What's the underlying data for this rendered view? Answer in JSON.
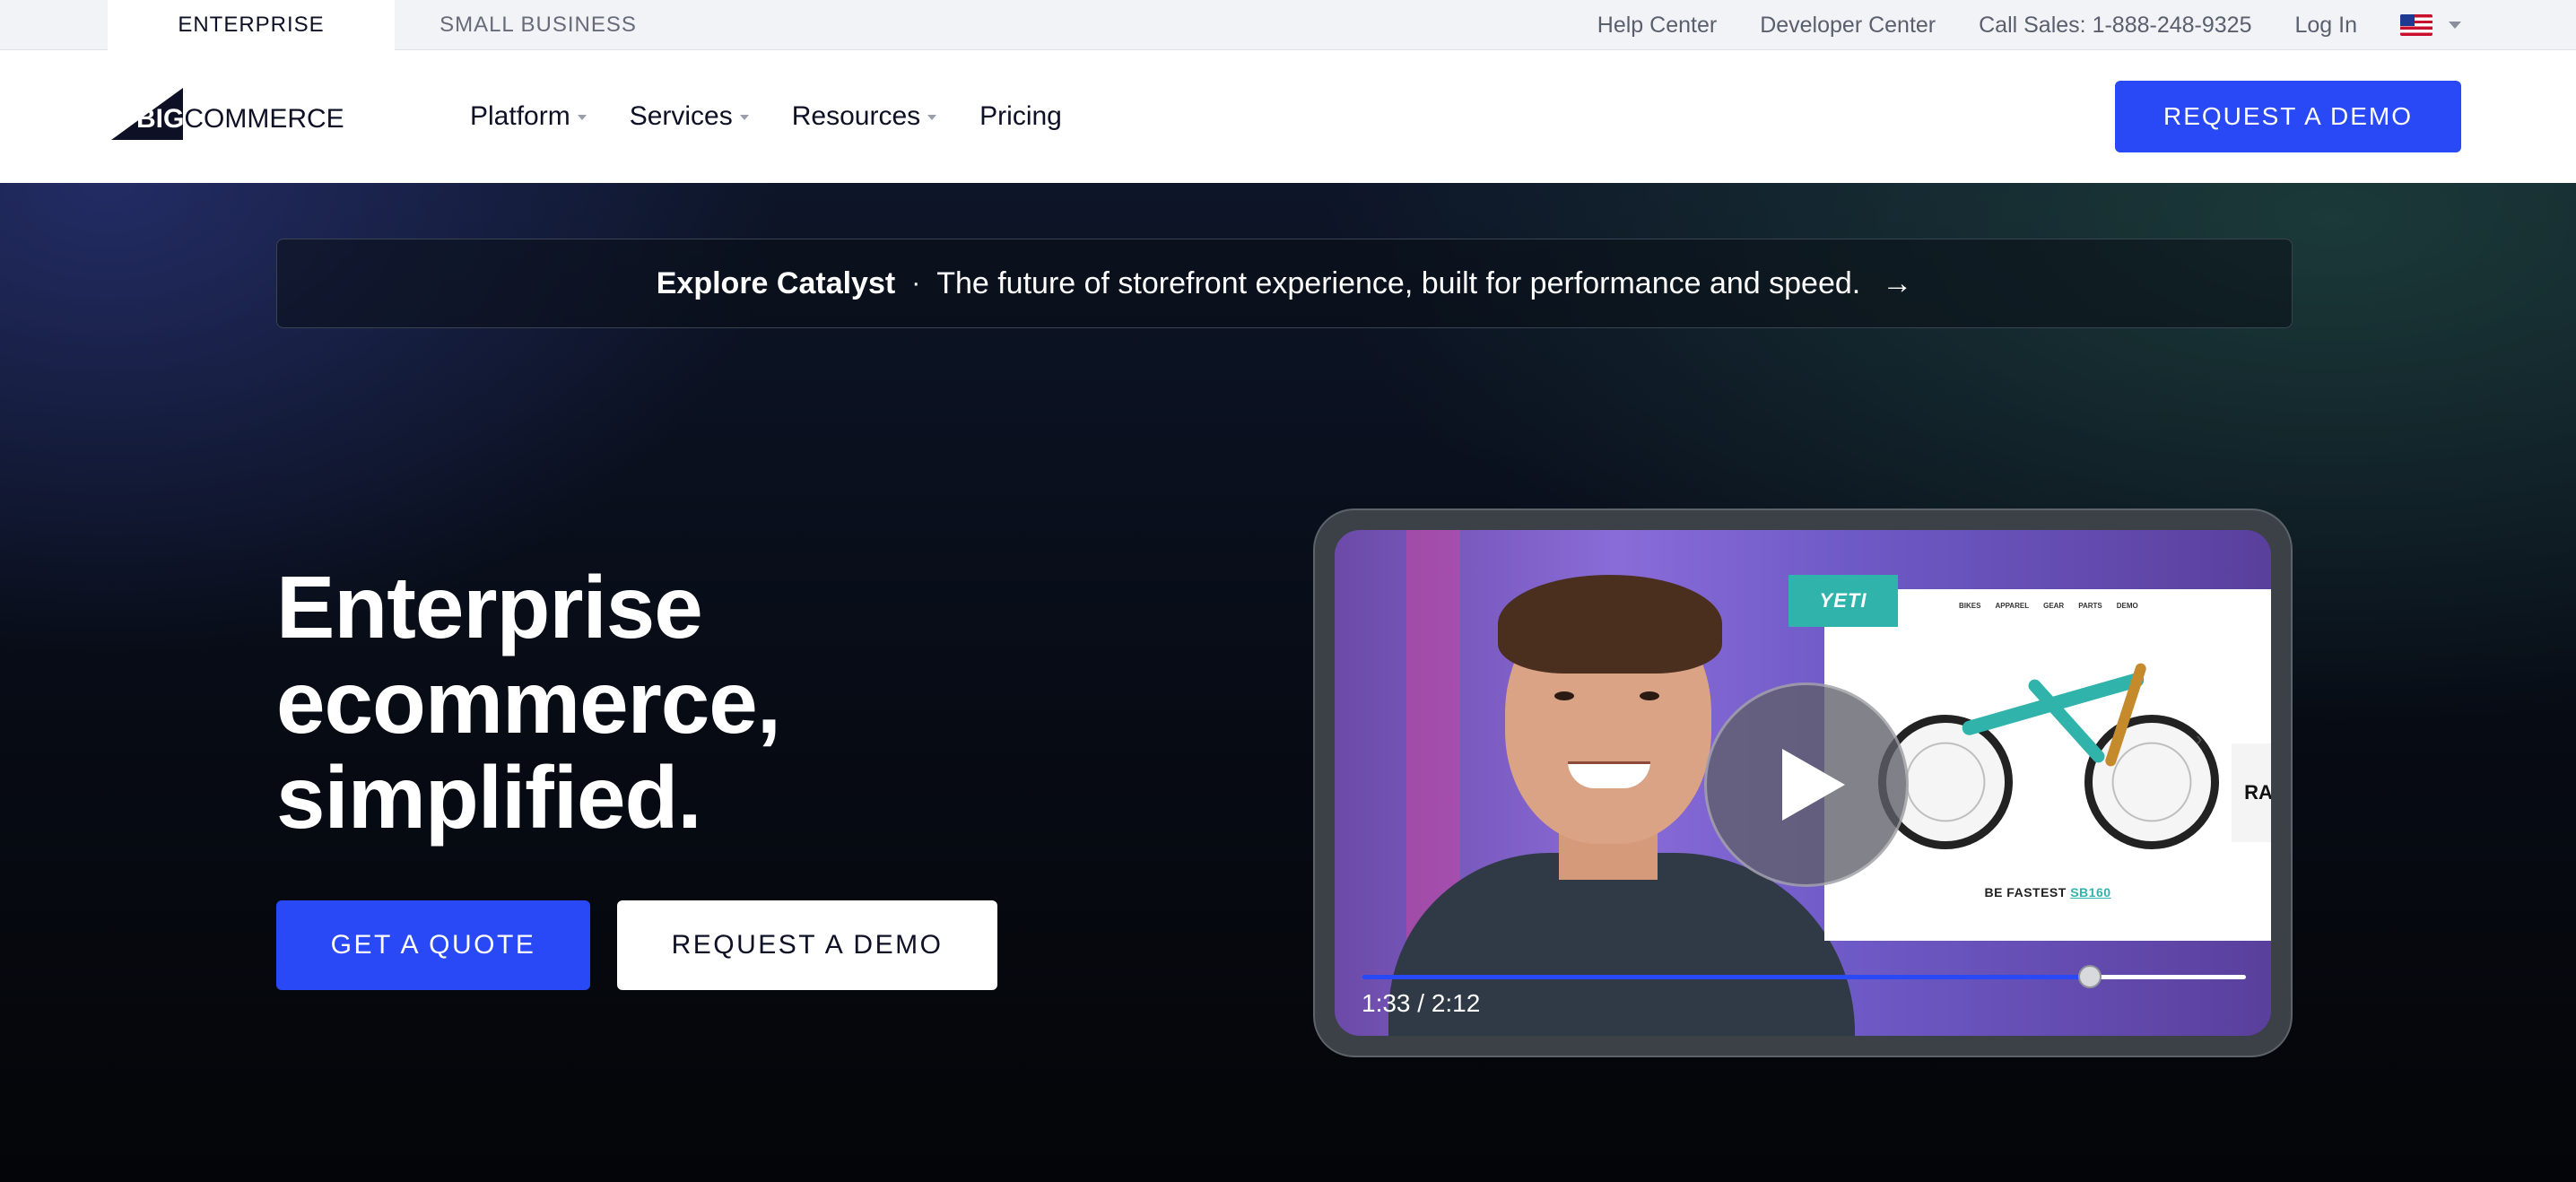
{
  "utility": {
    "tabs": [
      {
        "label": "ENTERPRISE",
        "active": true
      },
      {
        "label": "SMALL BUSINESS",
        "active": false
      }
    ],
    "links": [
      "Help Center",
      "Developer Center",
      "Call Sales: 1-888-248-9325",
      "Log In"
    ],
    "locale_icon": "us-flag-icon"
  },
  "nav": {
    "logo": {
      "big": "BIG",
      "rest": "COMMERCE"
    },
    "items": [
      {
        "label": "Platform",
        "has_menu": true
      },
      {
        "label": "Services",
        "has_menu": true
      },
      {
        "label": "Resources",
        "has_menu": true
      },
      {
        "label": "Pricing",
        "has_menu": false
      }
    ],
    "cta": "REQUEST A DEMO"
  },
  "announcement": {
    "strong": "Explore Catalyst",
    "separator": "·",
    "text": "The future of storefront experience, built for performance and speed.",
    "arrow": "→"
  },
  "hero": {
    "headline_lines": [
      "Enterprise",
      "ecommerce,",
      "simplified."
    ],
    "primary_cta": "GET A QUOTE",
    "secondary_cta": "REQUEST A DEMO"
  },
  "video": {
    "brand_badge": "YETI",
    "site_nav": [
      "BIKES",
      "APPAREL",
      "GEAR",
      "PARTS",
      "DEMO"
    ],
    "tagline_prefix": "BE FASTEST",
    "tagline_model": "SB160",
    "side_card_text": "RA",
    "current_time": "1:33",
    "duration": "2:12",
    "time_display": "1:33 / 2:12",
    "progress": 0.824,
    "colors": {
      "accent": "#2849f5",
      "brand_teal": "#2fb3aa"
    }
  },
  "colors": {
    "primary": "#2849f5",
    "dark": "#0e1126"
  }
}
